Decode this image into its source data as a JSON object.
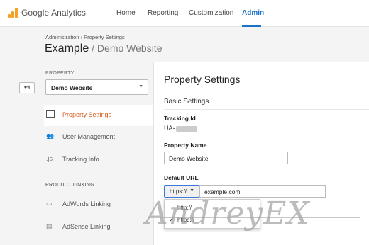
{
  "topbar": {
    "app_name": "Google Analytics",
    "nav": [
      "Home",
      "Reporting",
      "Customization",
      "Admin"
    ],
    "active": "Admin"
  },
  "header": {
    "breadcrumb": "Administration › Property Settings",
    "account": "Example",
    "separator": " / ",
    "property": "Demo Website"
  },
  "sidebar": {
    "property_label": "PROPERTY",
    "property_value": "Demo Website",
    "items": [
      {
        "label": "Property Settings",
        "icon": "property-box-icon",
        "active": true
      },
      {
        "label": "User Management",
        "icon": "users-icon",
        "active": false
      },
      {
        "label": "Tracking Info",
        "icon": "js-icon",
        "active": false
      }
    ],
    "section_label": "PRODUCT LINKING",
    "linking": [
      {
        "label": "AdWords Linking",
        "icon": "adwords-icon"
      },
      {
        "label": "AdSense Linking",
        "icon": "adsense-icon"
      }
    ]
  },
  "main": {
    "title": "Property Settings",
    "basic_settings": "Basic Settings",
    "tracking_id_label": "Tracking Id",
    "tracking_id_prefix": "UA-",
    "property_name_label": "Property Name",
    "property_name_value": "Demo Website",
    "default_url_label": "Default URL",
    "protocol_selected": "https://",
    "url_value": "example.com",
    "protocol_options": [
      "http://",
      "https://"
    ]
  },
  "watermark": "AndreyEX",
  "colors": {
    "accent": "#1a73c8",
    "active_menu": "#d85c1b",
    "logo": "#f4a223"
  }
}
